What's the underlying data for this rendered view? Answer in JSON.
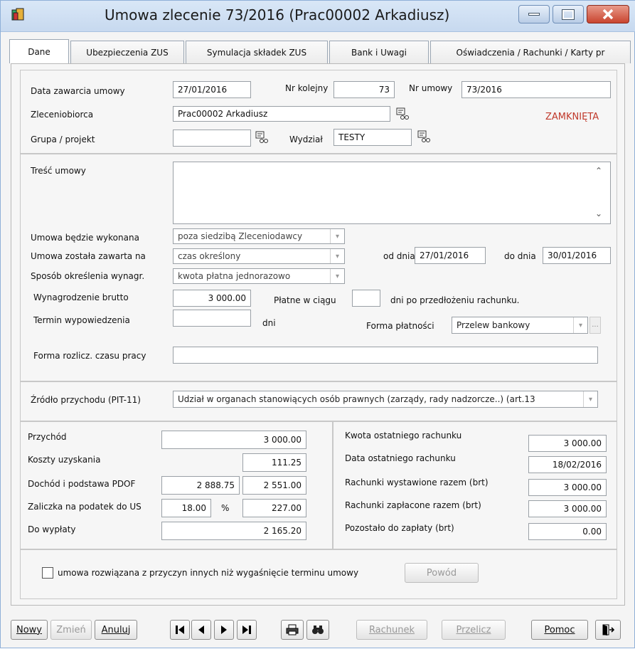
{
  "window": {
    "title": "Umowa zlecenie 73/2016 (Prac00002 Arkadiusz)"
  },
  "tabs": [
    "Dane",
    "Ubezpieczenia ZUS",
    "Symulacja składek ZUS",
    "Bank i Uwagi",
    "Oświadczenia / Rachunki / Karty pr"
  ],
  "header": {
    "data_zawarcia_label": "Data zawarcia umowy",
    "data_zawarcia": "27/01/2016",
    "nr_kolejny_label": "Nr kolejny",
    "nr_kolejny": "73",
    "nr_umowy_label": "Nr umowy",
    "nr_umowy": "73/2016",
    "zleceniobiorca_label": "Zleceniobiorca",
    "zleceniobiorca": "Prac00002 Arkadiusz",
    "status": "ZAMKNIĘTA",
    "grupa_label": "Grupa / projekt",
    "grupa": "",
    "wydzial_label": "Wydział",
    "wydzial": "TESTY"
  },
  "details": {
    "tresc_label": "Treść umowy",
    "tresc": "",
    "wykonana_label": "Umowa będzie wykonana",
    "wykonana": "poza siedzibą Zleceniodawcy",
    "zawarta_label": "Umowa została zawarta na",
    "zawarta": "czas określony",
    "od_label": "od dnia",
    "od": "27/01/2016",
    "do_label": "do dnia",
    "do": "30/01/2016",
    "sposob_label": "Sposób określenia wynagr.",
    "sposob": "kwota płatna jednorazowo",
    "brutto_label": "Wynagrodzenie brutto",
    "brutto": "3 000.00",
    "platne_label": "Płatne w ciągu",
    "platne": "",
    "platne_suffix": "dni po przedłożeniu rachunku.",
    "termin_label": "Termin wypowiedzenia",
    "termin": "",
    "dni_label": "dni",
    "forma_platnosci_label": "Forma płatności",
    "forma_platnosci": "Przelew bankowy",
    "forma_rozlicz_label": "Forma rozlicz. czasu pracy",
    "forma_rozlicz": ""
  },
  "zrodlo": {
    "label": "Źródło przychodu (PIT-11)",
    "value": "Udział w organach stanowiących osób prawnych (zarządy, rady nadzorcze..) (art.13"
  },
  "calc": {
    "przychod_label": "Przychód",
    "przychod": "3 000.00",
    "koszty_label": "Koszty uzyskania",
    "koszty": "111.25",
    "dochod_label": "Dochód i podstawa PDOF",
    "dochod": "2 888.75",
    "podstawa": "2 551.00",
    "zaliczka_label": "Zaliczka na podatek do US",
    "zaliczka_pct": "18.00",
    "pct_sign": "%",
    "zaliczka": "227.00",
    "wyplata_label": "Do wypłaty",
    "wyplata": "2 165.20"
  },
  "summary": {
    "kwota_label": "Kwota ostatniego rachunku",
    "kwota": "3 000.00",
    "data_label": "Data ostatniego rachunku",
    "data": "18/02/2016",
    "wystawione_label": "Rachunki wystawione razem (brt)",
    "wystawione": "3 000.00",
    "zaplacone_label": "Rachunki zapłacone razem (brt)",
    "zaplacone": "3 000.00",
    "pozostalo_label": "Pozostało do zapłaty (brt)",
    "pozostalo": "0.00"
  },
  "termination": {
    "label": "umowa rozwiązana z przyczyn innych niż wygaśnięcie terminu umowy",
    "powod": "Powód"
  },
  "toolbar": {
    "nowy": "Nowy",
    "zmien": "Zmień",
    "anuluj": "Anuluj",
    "rachunek": "Rachunek",
    "przelicz": "Przelicz",
    "pomoc": "Pomoc"
  },
  "icons": [
    "app-icon",
    "minimize-icon",
    "maximize-icon",
    "close-icon",
    "picker-icon",
    "first-record-icon",
    "prev-record-icon",
    "next-record-icon",
    "last-record-icon",
    "printer-icon",
    "binoculars-icon",
    "exit-icon"
  ],
  "colors": {
    "status": "#c0392b",
    "close": "#d0493b",
    "titlebar": "#c7d9ef"
  }
}
